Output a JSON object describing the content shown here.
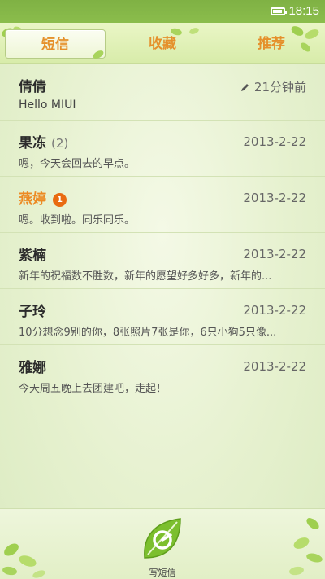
{
  "status_bar": {
    "time": "18:15",
    "battery": 0.8
  },
  "tabs": [
    {
      "label": "短信",
      "active": true
    },
    {
      "label": "收藏",
      "active": false
    },
    {
      "label": "推荐",
      "active": false
    }
  ],
  "messages": [
    {
      "name": "倩倩",
      "preview": "Hello MIUI",
      "date": "21分钟前",
      "draft": true
    },
    {
      "name": "果冻",
      "count": "(2)",
      "preview": "嗯，今天会回去的早点。",
      "date": "2013-2-22"
    },
    {
      "name": "燕婷",
      "unread_badge": "1",
      "preview": "嗯。收到啦。同乐同乐。",
      "date": "2013-2-22"
    },
    {
      "name": "紫楠",
      "preview": "新年的祝福数不胜数，新年的愿望好多好多，新年的...",
      "date": "2013-2-22"
    },
    {
      "name": "子玲",
      "preview": "10分想念9别的你，8张照片7张是你，6只小狗5只像...",
      "date": "2013-2-22"
    },
    {
      "name": "雅娜",
      "preview": "今天周五晚上去团建吧，走起！",
      "date": "2013-2-22"
    }
  ],
  "compose": {
    "label": "写短信"
  },
  "colors": {
    "accent": "#ec8a23",
    "status_bar": "#7fb144",
    "badge": "#e96b11"
  }
}
